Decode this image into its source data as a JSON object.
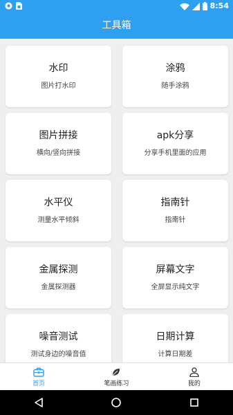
{
  "status_bar": {
    "time": "8:54"
  },
  "app_bar": {
    "title": "工具箱"
  },
  "tools": [
    {
      "title": "水印",
      "desc": "图片打水印"
    },
    {
      "title": "涂鸦",
      "desc": "随手涂鸦"
    },
    {
      "title": "图片拼接",
      "desc": "横向/竖向拼接"
    },
    {
      "title": "apk分享",
      "desc": "分享手机里面的应用"
    },
    {
      "title": "水平仪",
      "desc": "测量水平倾斜"
    },
    {
      "title": "指南针",
      "desc": "指南针"
    },
    {
      "title": "金属探测",
      "desc": "金属探测器"
    },
    {
      "title": "屏幕文字",
      "desc": "全屏显示纯文字"
    },
    {
      "title": "噪音测试",
      "desc": "测试身边的噪音值"
    },
    {
      "title": "日期计算",
      "desc": "计算日期差"
    }
  ],
  "bottom_nav": {
    "items": [
      {
        "label": "首页",
        "icon": "toolbox-icon",
        "active": true
      },
      {
        "label": "笔画练习",
        "icon": "leaf-icon",
        "active": false
      },
      {
        "label": "我的",
        "icon": "person-icon",
        "active": false
      }
    ]
  },
  "colors": {
    "accent": "#2f9ff0",
    "background": "#efefef",
    "card": "#ffffff"
  }
}
